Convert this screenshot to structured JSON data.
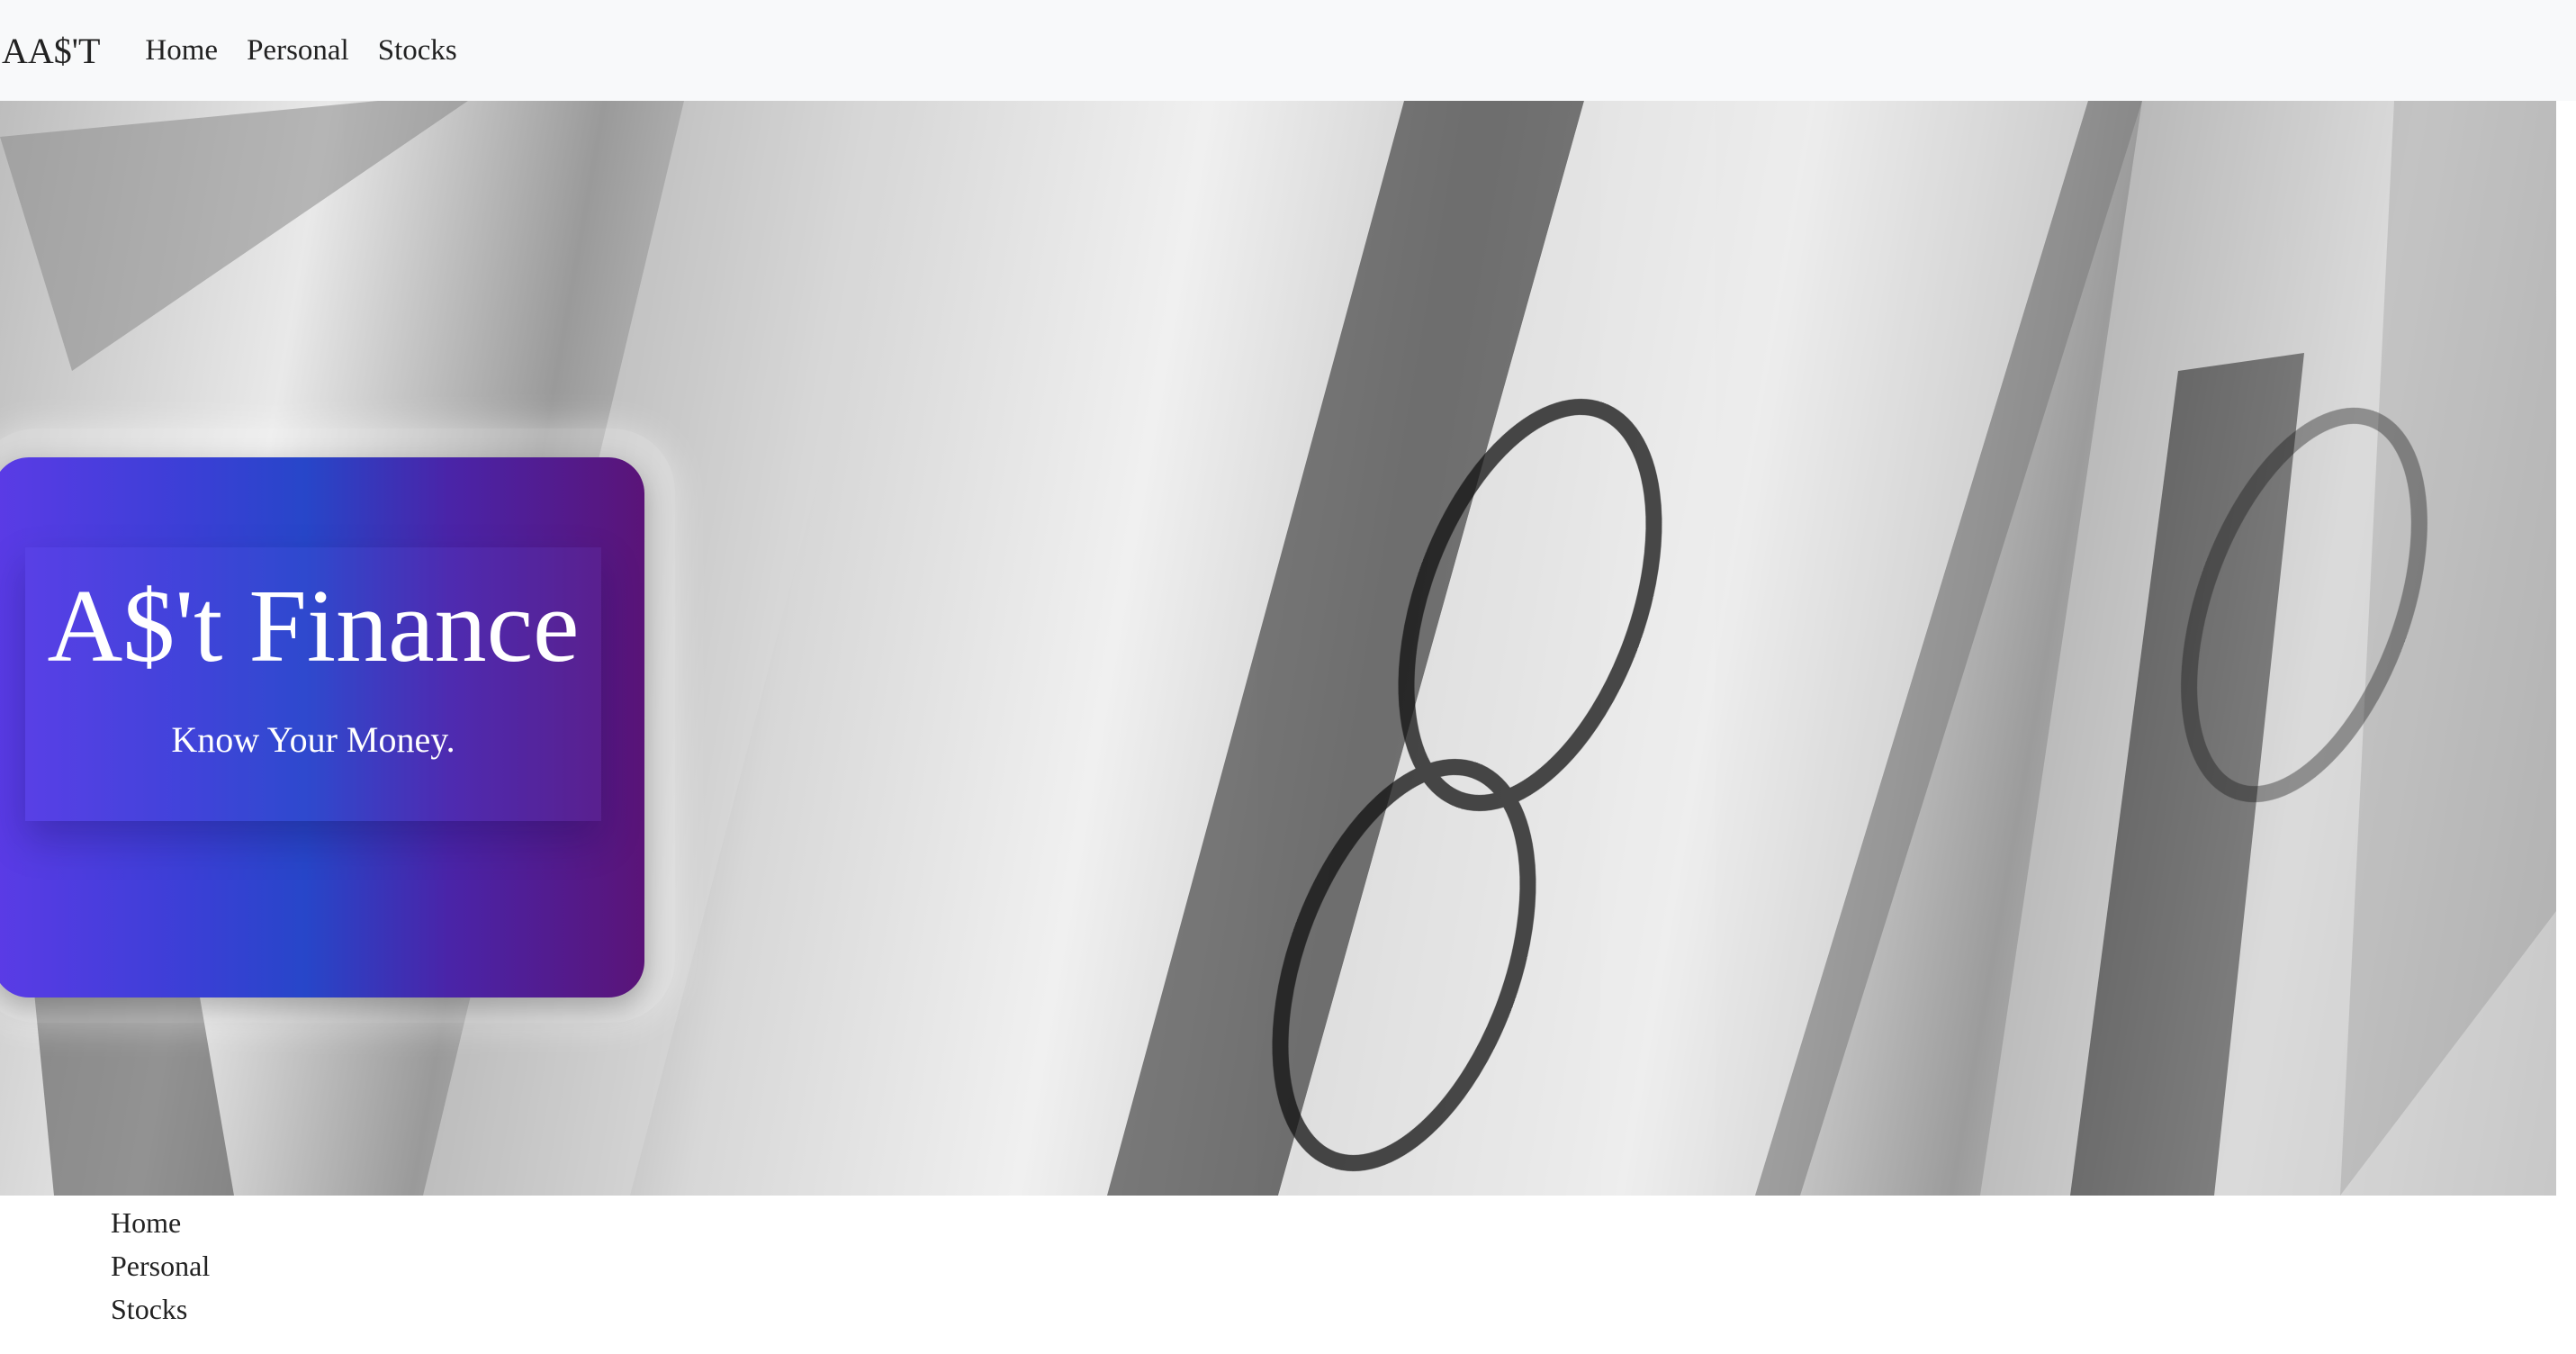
{
  "navbar": {
    "brand": "AA$'T",
    "links": [
      "Home",
      "Personal",
      "Stocks"
    ]
  },
  "hero": {
    "title": "A$'t Finance",
    "subtitle": "Know Your Money.",
    "background_image": "blurred-hundred-dollar-bills-photo"
  },
  "bottom_nav": {
    "links": [
      "Home",
      "Personal",
      "Stocks"
    ]
  },
  "colors": {
    "navbar_bg": "#f8f9fa",
    "card_gradient_start": "#5b3be6",
    "card_gradient_mid": "#2746c9",
    "card_gradient_end": "#5a1478",
    "text_light": "#ffffff",
    "text_dark": "#222222"
  }
}
